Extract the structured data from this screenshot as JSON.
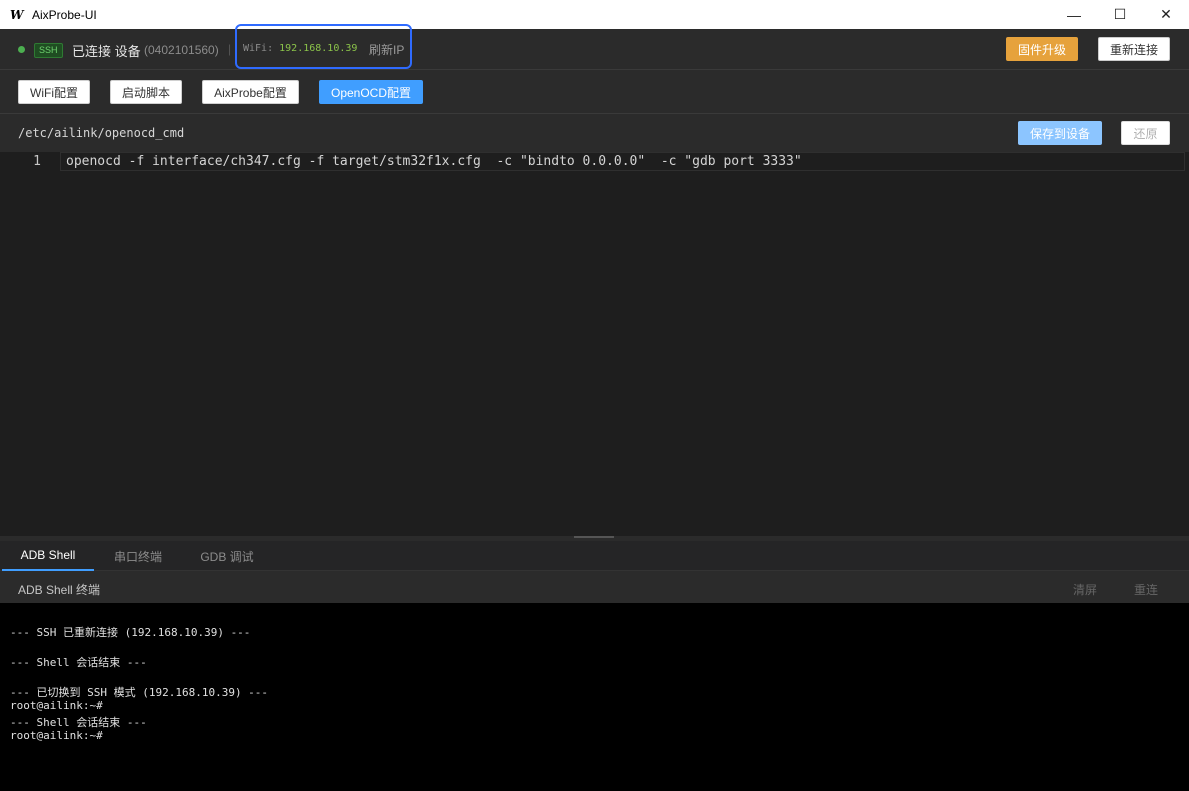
{
  "window": {
    "title": "AixProbe-UI",
    "logo": "W",
    "minimize": "—",
    "maximize": "☐",
    "close": "✕"
  },
  "status": {
    "protocol_badge": "SSH",
    "connection_label": "已连接 设备",
    "device_id": "(0402101560)",
    "separator": "|",
    "wifi_label": "WiFi:",
    "wifi_ip": "192.168.10.39",
    "refresh_ip": "刷新IP",
    "firmware_upgrade": "固件升级",
    "reconnect": "重新连接",
    "status_color": "#4caf50"
  },
  "tabs": [
    {
      "label": "WiFi配置",
      "active": false
    },
    {
      "label": "启动脚本",
      "active": false
    },
    {
      "label": "AixProbe配置",
      "active": false
    },
    {
      "label": "OpenOCD配置",
      "active": true
    }
  ],
  "file": {
    "path": "/etc/ailink/openocd_cmd",
    "save_button": "保存到设备",
    "restore_button": "还原"
  },
  "editor": {
    "lines": [
      {
        "number": "1",
        "text": "openocd -f interface/ch347.cfg -f target/stm32f1x.cfg  -c \"bindto 0.0.0.0\"  -c \"gdb port 3333\""
      }
    ]
  },
  "bottom_panel": {
    "tabs": [
      {
        "label": "ADB Shell",
        "active": true
      },
      {
        "label": "串口终端",
        "active": false
      },
      {
        "label": "GDB 调试",
        "active": false
      }
    ],
    "terminal_title": "ADB Shell 终端",
    "clear_button": "清屏",
    "reconnect_button": "重连",
    "output": [
      "--- SSH 已重新连接 (192.168.10.39) ---",
      "--- Shell 会话结束 ---",
      "--- 已切换到 SSH 模式 (192.168.10.39) ---",
      "root@ailink:~#",
      "--- Shell 会话结束 ---",
      "root@ailink:~#"
    ]
  },
  "colors": {
    "accent": "#409eff",
    "warning": "#e6a23c",
    "highlight_box": "#2f6bff"
  }
}
